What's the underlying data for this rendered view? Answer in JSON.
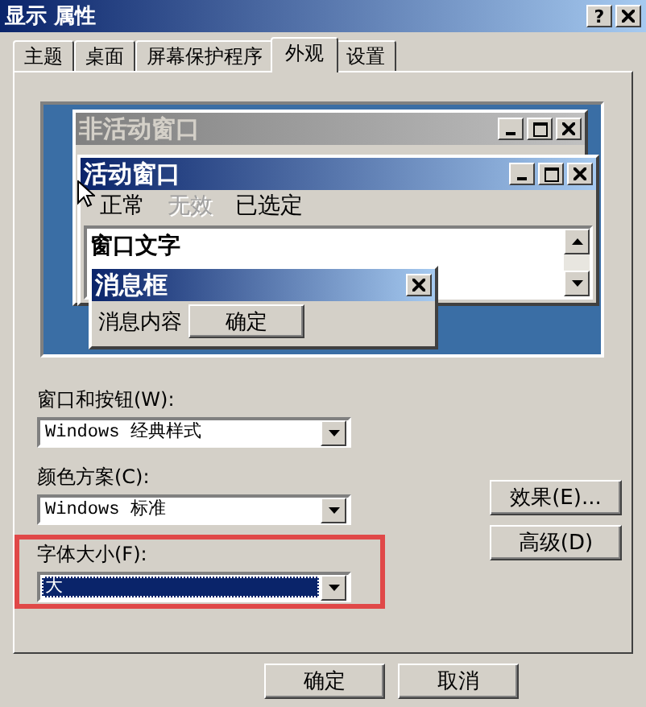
{
  "window": {
    "title": "显示 属性",
    "help": "?"
  },
  "tabs": [
    {
      "label": "主题",
      "selected": false
    },
    {
      "label": "桌面",
      "selected": false
    },
    {
      "label": "屏幕保护程序",
      "selected": false
    },
    {
      "label": "外观",
      "selected": true
    },
    {
      "label": "设置",
      "selected": false
    }
  ],
  "preview": {
    "inactive_window": {
      "title": "非活动窗口"
    },
    "active_window": {
      "title": "活动窗口",
      "menu": [
        {
          "label": "正常",
          "disabled": false
        },
        {
          "label": "无效",
          "disabled": true
        },
        {
          "label": "已选定",
          "disabled": false
        }
      ],
      "window_text": "窗口文字"
    },
    "message_box": {
      "title": "消息框",
      "text": "消息内容",
      "button": "确定"
    }
  },
  "fields": [
    {
      "label": "窗口和按钮(W):",
      "value": "Windows 经典样式",
      "selected": false,
      "highlighted": false
    },
    {
      "label": "颜色方案(C):",
      "value": "Windows 标准",
      "selected": false,
      "highlighted": false
    },
    {
      "label": "字体大小(F):",
      "value": "大",
      "selected": true,
      "highlighted": true
    }
  ],
  "side_buttons": [
    "效果(E)...",
    "高级(D)"
  ],
  "footer_buttons": [
    "确定",
    "取消"
  ]
}
